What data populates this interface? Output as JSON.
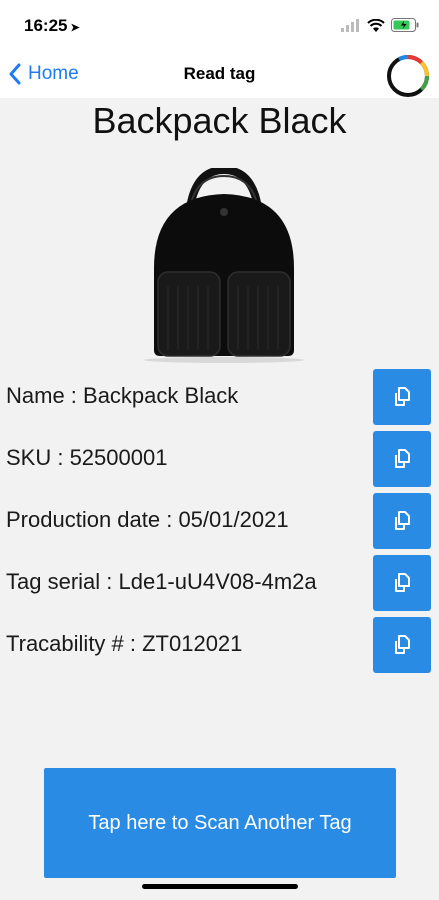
{
  "status_bar": {
    "time": "16:25",
    "location_glyph": "➤"
  },
  "nav": {
    "back_label": "Home",
    "title": "Read tag"
  },
  "product": {
    "title": "Backpack Black"
  },
  "fields": [
    {
      "text": "Name : Backpack Black"
    },
    {
      "text": "SKU : 52500001"
    },
    {
      "text": "Production date : 05/01/2021"
    },
    {
      "text": "Tag serial : Lde1-uU4V08-4m2a"
    },
    {
      "text": "Tracability # : ZT012021"
    }
  ],
  "scan_button": {
    "label": "Tap here to Scan Another Tag"
  },
  "colors": {
    "accent": "#2a8be5",
    "link": "#1e7bf0",
    "background": "#f2f2f2"
  },
  "icons": [
    "location-arrow-icon",
    "signal-icon",
    "wifi-icon",
    "battery-icon",
    "chevron-left-icon",
    "activity-ring-icon",
    "copy-icon"
  ]
}
